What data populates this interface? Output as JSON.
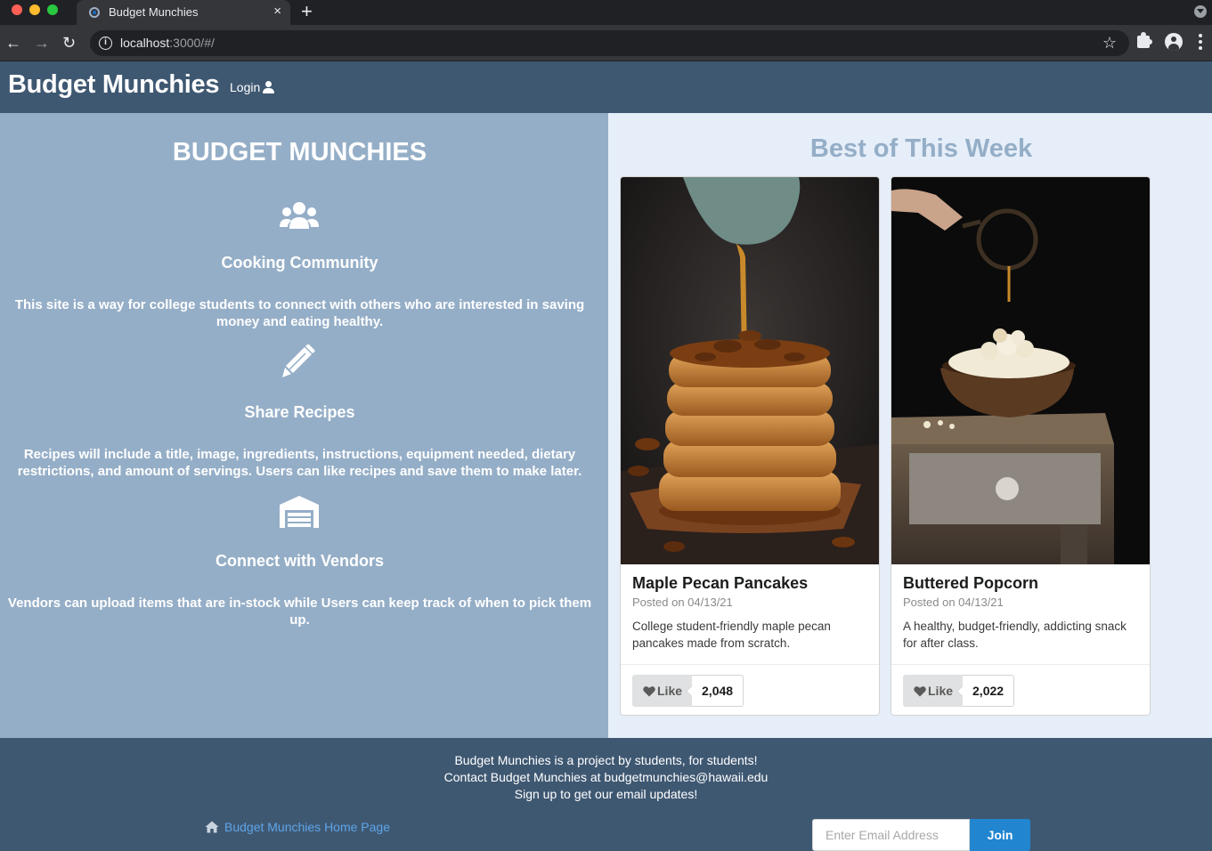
{
  "browser": {
    "tab_title": "Budget Munchies",
    "tab_close": "×",
    "new_tab": "+",
    "url_host": "localhost",
    "url_rest": ":3000/#/"
  },
  "navbar": {
    "brand": "Budget Munchies",
    "login_label": "Login"
  },
  "left": {
    "heading": "BUDGET MUNCHIES",
    "features": [
      {
        "icon": "users-icon",
        "title": "Cooking Community",
        "description": "This site is a way for college students to connect with others who are interested in saving money and eating healthy."
      },
      {
        "icon": "pencil-icon",
        "title": "Share Recipes",
        "description": "Recipes will include a title, image, ingredients, instructions, equipment needed, dietary restrictions, and amount of servings. Users can like recipes and save them to make later."
      },
      {
        "icon": "warehouse-icon",
        "title": "Connect with Vendors",
        "description": "Vendors can upload items that are in-stock while Users can keep track of when to pick them up."
      }
    ]
  },
  "right": {
    "heading": "Best of This Week",
    "cards": [
      {
        "title": "Maple Pecan Pancakes",
        "meta": "Posted on 04/13/21",
        "description": "College student-friendly maple pecan pancakes made from scratch.",
        "like_label": "Like",
        "like_count": "2,048"
      },
      {
        "title": "Buttered Popcorn",
        "meta": "Posted on 04/13/21",
        "description": "A healthy, budget-friendly, addicting snack for after class.",
        "like_label": "Like",
        "like_count": "2,022"
      }
    ]
  },
  "footer": {
    "line1": "Budget Munchies is a project by students, for students!",
    "line2": "Contact Budget Munchies at budgetmunchies@hawaii.edu",
    "line3": "Sign up to get our email updates!",
    "home_link": "Budget Munchies Home Page",
    "email_placeholder": "Enter Email Address",
    "join_label": "Join"
  },
  "colors": {
    "navbar": "#3f5872",
    "left_panel": "#95aec7",
    "right_panel": "#e5eef9",
    "accent_blue": "#2185d0",
    "link": "#5ea5e8"
  }
}
